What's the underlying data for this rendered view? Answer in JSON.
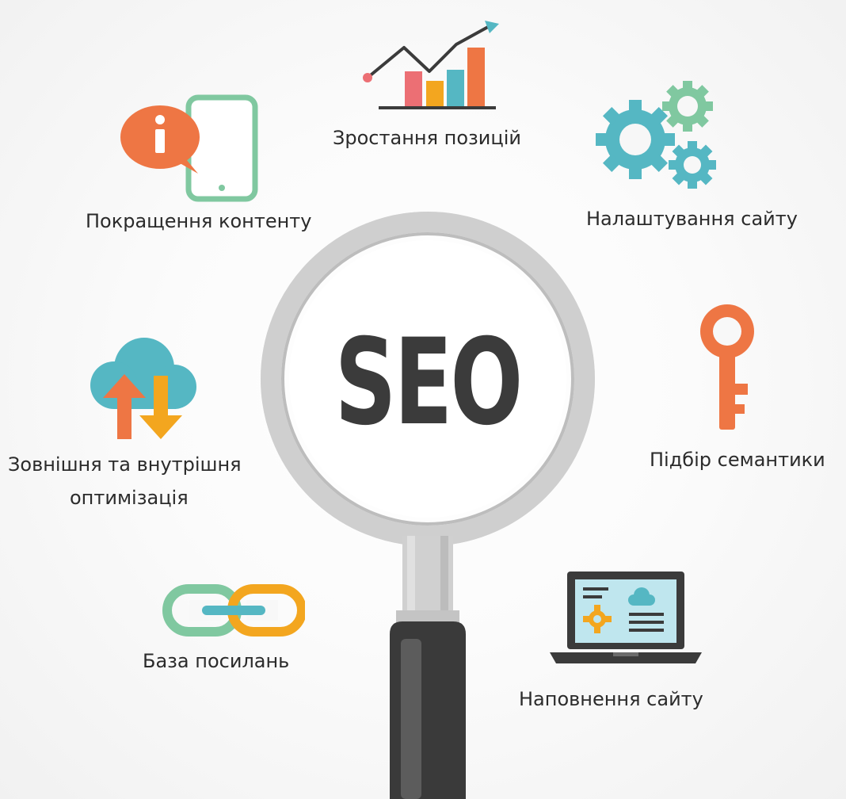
{
  "center_text": "SEO",
  "labels": {
    "growth": "Зростання позицій",
    "content": "Покращення контенту",
    "settings": "Налаштування сайту",
    "optimization_line1": "Зовнішня та внутрішня",
    "optimization_line2": "оптимізація",
    "semantics": "Підбір семантики",
    "links": "База посилань",
    "filling": "Наповнення сайту"
  },
  "icons": {
    "growth": "growth-chart-icon",
    "content": "tablet-info-icon",
    "settings": "gears-icon",
    "optimization": "cloud-sync-icon",
    "semantics": "key-icon",
    "links": "chain-link-icon",
    "filling": "laptop-icon",
    "center": "magnifying-glass-icon"
  },
  "colors": {
    "orange": "#ee7644",
    "teal": "#55b7c3",
    "green": "#80c8a0",
    "yellow": "#f3a61f",
    "red": "#ec6f74",
    "dark": "#3b3b3b",
    "ring": "#c9c9c9"
  }
}
